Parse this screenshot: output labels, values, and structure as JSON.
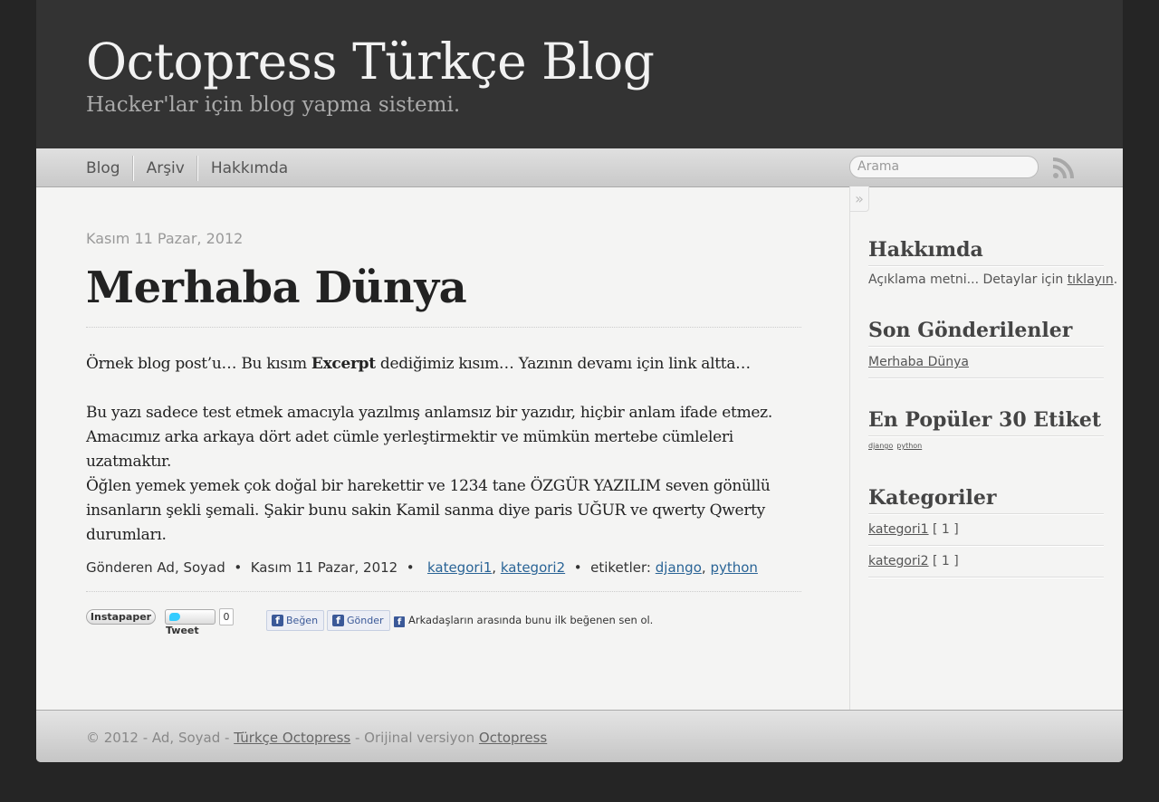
{
  "header": {
    "title": "Octopress Türkçe Blog",
    "subtitle": "Hacker'lar için blog yapma sistemi."
  },
  "nav": {
    "items": [
      {
        "label": "Blog"
      },
      {
        "label": "Arşiv"
      },
      {
        "label": "Hakkımda"
      }
    ],
    "search_placeholder": "Arama",
    "rss_icon": "rss-icon"
  },
  "post": {
    "date": "Kasım 11 Pazar, 2012",
    "title": "Merhaba Dünya",
    "para1_before": "Örnek blog post’u… Bu kısım ",
    "para1_bold": "Excerpt",
    "para1_after": " dediğimiz kısım… Yazının devamı için link altta…",
    "para2": "Bu yazı sadece test etmek amacıyla yazılmış anlamsız bir yazıdır, hiçbir anlam ifade etmez. Amacımız arka arkaya dört adet cümle yerleştirmektir ve mümkün mertebe cümleleri uzatmaktır.",
    "para3": "Öğlen yemek yemek çok doğal bir harekettir ve 1234 tane ÖZGÜR YAZILIM seven gönüllü insanların şekli şemali. Şakir bunu sakin Kamil sanma diye paris UĞUR ve qwerty Qwerty durumları.",
    "meta": {
      "author_prefix": "Gönderen",
      "author": "Ad, Soyad",
      "sep": "•",
      "date": "Kasım 11 Pazar, 2012",
      "categories": [
        "kategori1",
        "kategori2"
      ],
      "comma": ",",
      "tags_label": "etiketler:",
      "tags": [
        "django",
        "python"
      ]
    },
    "sharing": {
      "instapaper": "Instapaper",
      "tweet": "Tweet",
      "tweet_count": "0",
      "like": "Beğen",
      "send": "Gönder",
      "fb_text": "Arkadaşların arasında bunu ilk beğenen sen ol."
    }
  },
  "sidebar": {
    "toggle": "»",
    "about": {
      "title": "Hakkımda",
      "text": "Açıklama metni... Detaylar için ",
      "link": "tıklayın",
      "end": "."
    },
    "recent": {
      "title": "Son Gönderilenler",
      "items": [
        "Merhaba Dünya"
      ]
    },
    "tags": {
      "title": "En Popüler 30 Etiket",
      "items": [
        "django",
        "python"
      ]
    },
    "categories": {
      "title": "Kategoriler",
      "items": [
        {
          "name": "kategori1",
          "count": "[ 1 ]"
        },
        {
          "name": "kategori2",
          "count": "[ 1 ]"
        }
      ]
    }
  },
  "footer": {
    "copyright": "© 2012 - Ad, Soyad - ",
    "link1": "Türkçe Octopress",
    "middle": " - Orijinal versiyon ",
    "link2": "Octopress"
  },
  "colors": {
    "page_bg": "#252525",
    "header_bg": "#333333",
    "link": "#2a6496",
    "facebook": "#3b5998"
  }
}
